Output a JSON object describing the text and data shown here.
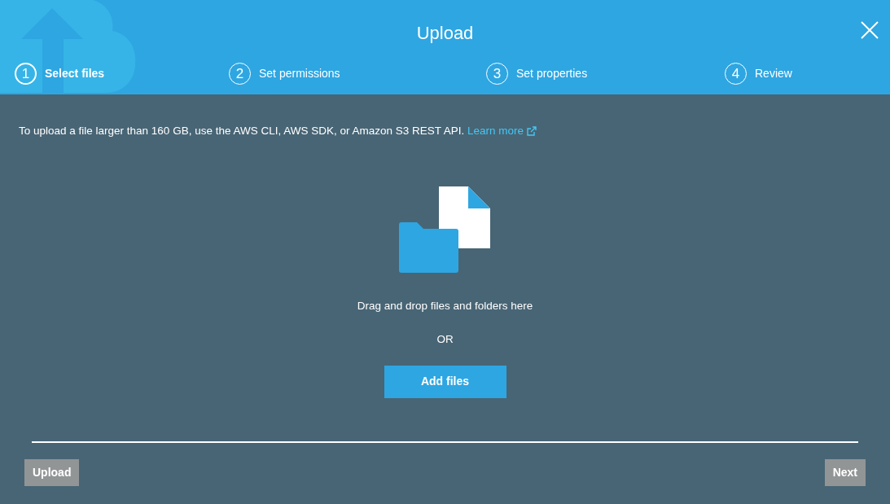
{
  "dialog": {
    "title": "Upload"
  },
  "steps": [
    {
      "number": "1",
      "label": "Select files",
      "selected": true
    },
    {
      "number": "2",
      "label": "Set permissions",
      "selected": false
    },
    {
      "number": "3",
      "label": "Set properties",
      "selected": false
    },
    {
      "number": "4",
      "label": "Review",
      "selected": false
    }
  ],
  "notice": {
    "text": "To upload a file larger than 160 GB, use the AWS CLI, AWS SDK, or Amazon S3 REST API.",
    "link": "Learn more"
  },
  "dropzone": {
    "hint": "Drag and drop files and folders here",
    "separator": "OR",
    "button": "Add files"
  },
  "footer": {
    "buttons": [
      {
        "label": "Upload",
        "disabled": true
      },
      {
        "label": "Next",
        "disabled": true
      }
    ]
  }
}
